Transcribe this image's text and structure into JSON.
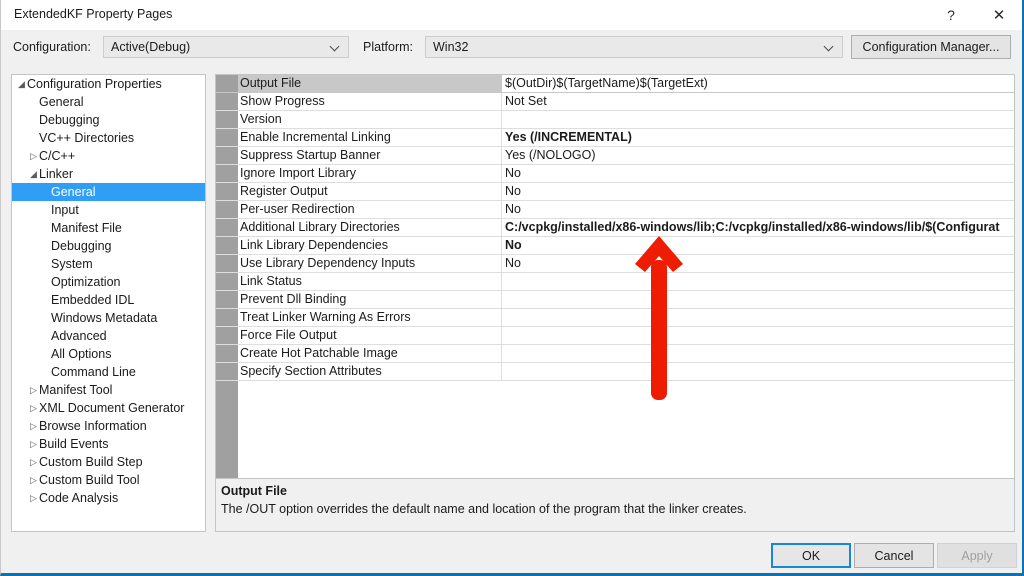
{
  "window": {
    "title": "ExtendedKF Property Pages",
    "help_icon": "?",
    "close_icon": "✕"
  },
  "config_bar": {
    "configuration_label": "Configuration:",
    "configuration_value": "Active(Debug)",
    "platform_label": "Platform:",
    "platform_value": "Win32",
    "configuration_manager_label": "Configuration Manager..."
  },
  "tree": {
    "items": [
      {
        "label": "Configuration Properties",
        "indent": 0,
        "twisty": "◢",
        "selected": false
      },
      {
        "label": "General",
        "indent": 1,
        "twisty": "",
        "selected": false
      },
      {
        "label": "Debugging",
        "indent": 1,
        "twisty": "",
        "selected": false
      },
      {
        "label": "VC++ Directories",
        "indent": 1,
        "twisty": "",
        "selected": false
      },
      {
        "label": "C/C++",
        "indent": 1,
        "twisty": "▷",
        "selected": false
      },
      {
        "label": "Linker",
        "indent": 1,
        "twisty": "◢",
        "selected": false
      },
      {
        "label": "General",
        "indent": 2,
        "twisty": "",
        "selected": true
      },
      {
        "label": "Input",
        "indent": 2,
        "twisty": "",
        "selected": false
      },
      {
        "label": "Manifest File",
        "indent": 2,
        "twisty": "",
        "selected": false
      },
      {
        "label": "Debugging",
        "indent": 2,
        "twisty": "",
        "selected": false
      },
      {
        "label": "System",
        "indent": 2,
        "twisty": "",
        "selected": false
      },
      {
        "label": "Optimization",
        "indent": 2,
        "twisty": "",
        "selected": false
      },
      {
        "label": "Embedded IDL",
        "indent": 2,
        "twisty": "",
        "selected": false
      },
      {
        "label": "Windows Metadata",
        "indent": 2,
        "twisty": "",
        "selected": false
      },
      {
        "label": "Advanced",
        "indent": 2,
        "twisty": "",
        "selected": false
      },
      {
        "label": "All Options",
        "indent": 2,
        "twisty": "",
        "selected": false
      },
      {
        "label": "Command Line",
        "indent": 2,
        "twisty": "",
        "selected": false
      },
      {
        "label": "Manifest Tool",
        "indent": 1,
        "twisty": "▷",
        "selected": false
      },
      {
        "label": "XML Document Generator",
        "indent": 1,
        "twisty": "▷",
        "selected": false
      },
      {
        "label": "Browse Information",
        "indent": 1,
        "twisty": "▷",
        "selected": false
      },
      {
        "label": "Build Events",
        "indent": 1,
        "twisty": "▷",
        "selected": false
      },
      {
        "label": "Custom Build Step",
        "indent": 1,
        "twisty": "▷",
        "selected": false
      },
      {
        "label": "Custom Build Tool",
        "indent": 1,
        "twisty": "▷",
        "selected": false
      },
      {
        "label": "Code Analysis",
        "indent": 1,
        "twisty": "▷",
        "selected": false
      }
    ]
  },
  "grid": {
    "rows": [
      {
        "name": "Output File",
        "value": "$(OutDir)$(TargetName)$(TargetExt)",
        "bold": false,
        "selected": true
      },
      {
        "name": "Show Progress",
        "value": "Not Set",
        "bold": false,
        "selected": false
      },
      {
        "name": "Version",
        "value": "",
        "bold": false,
        "selected": false
      },
      {
        "name": "Enable Incremental Linking",
        "value": "Yes (/INCREMENTAL)",
        "bold": true,
        "selected": false
      },
      {
        "name": "Suppress Startup Banner",
        "value": "Yes (/NOLOGO)",
        "bold": false,
        "selected": false
      },
      {
        "name": "Ignore Import Library",
        "value": "No",
        "bold": false,
        "selected": false
      },
      {
        "name": "Register Output",
        "value": "No",
        "bold": false,
        "selected": false
      },
      {
        "name": "Per-user Redirection",
        "value": "No",
        "bold": false,
        "selected": false
      },
      {
        "name": "Additional Library Directories",
        "value": "C:/vcpkg/installed/x86-windows/lib;C:/vcpkg/installed/x86-windows/lib/$(Configurat",
        "bold": true,
        "selected": false
      },
      {
        "name": "Link Library Dependencies",
        "value": "No",
        "bold": true,
        "selected": false
      },
      {
        "name": "Use Library Dependency Inputs",
        "value": "No",
        "bold": false,
        "selected": false
      },
      {
        "name": "Link Status",
        "value": "",
        "bold": false,
        "selected": false
      },
      {
        "name": "Prevent Dll Binding",
        "value": "",
        "bold": false,
        "selected": false
      },
      {
        "name": "Treat Linker Warning As Errors",
        "value": "",
        "bold": false,
        "selected": false
      },
      {
        "name": "Force File Output",
        "value": "",
        "bold": false,
        "selected": false
      },
      {
        "name": "Create Hot Patchable Image",
        "value": "",
        "bold": false,
        "selected": false
      },
      {
        "name": "Specify Section Attributes",
        "value": "",
        "bold": false,
        "selected": false
      }
    ]
  },
  "description": {
    "title": "Output File",
    "body": "The /OUT option overrides the default name and location of the program that the linker creates."
  },
  "buttons": {
    "ok": "OK",
    "cancel": "Cancel",
    "apply": "Apply"
  },
  "annotation": {
    "arrow_color": "#ee1c00",
    "direction": "up",
    "points_at": "Additional Library Directories"
  }
}
